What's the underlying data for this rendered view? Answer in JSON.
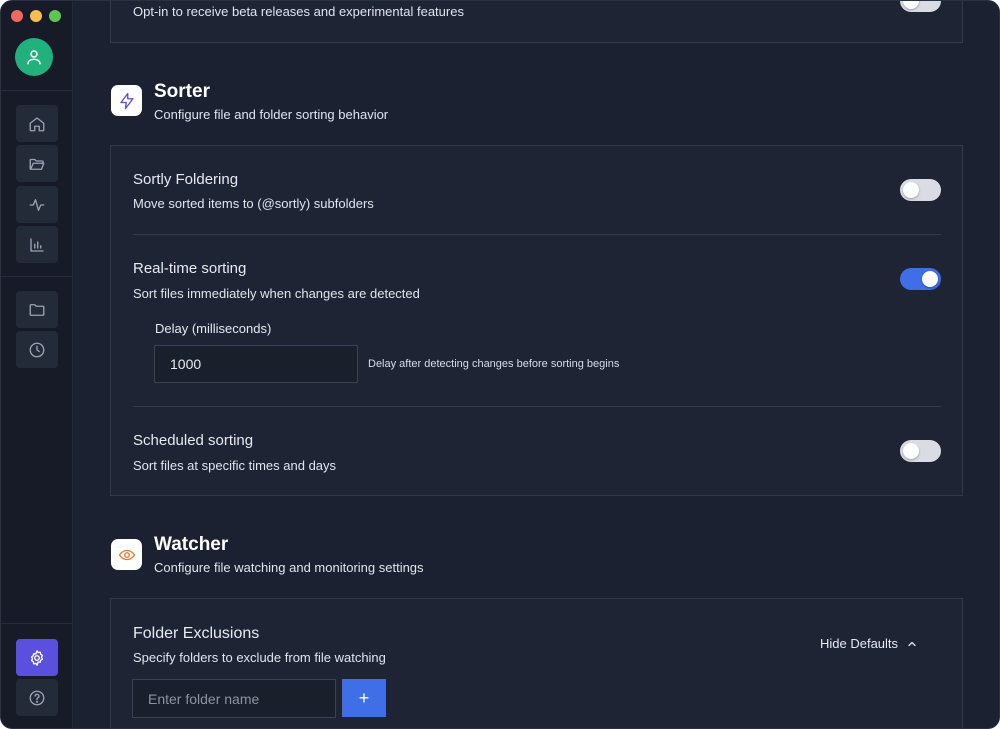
{
  "top_setting": {
    "description": "Opt-in to receive beta releases and experimental features"
  },
  "sorter": {
    "title": "Sorter",
    "subtitle": "Configure file and folder sorting behavior",
    "icon": "lightning-icon",
    "settings": [
      {
        "title": "Sortly Foldering",
        "description": "Move sorted items to (@sortly) subfolders",
        "enabled": false
      },
      {
        "title": "Real-time sorting",
        "description": "Sort files immediately when changes are detected",
        "enabled": true
      },
      {
        "title": "Scheduled sorting",
        "description": "Sort files at specific times and days",
        "enabled": false
      }
    ],
    "delay": {
      "label": "Delay (milliseconds)",
      "value": "1000",
      "hint": "Delay after detecting changes before sorting begins"
    }
  },
  "watcher": {
    "title": "Watcher",
    "subtitle": "Configure file watching and monitoring settings",
    "icon": "eye-icon",
    "exclusions": {
      "title": "Folder Exclusions",
      "description": "Specify folders to exclude from file watching",
      "hide_defaults_label": "Hide Defaults",
      "placeholder": "Enter folder name",
      "add_label": "+"
    }
  },
  "colors": {
    "accent_blue": "#3f6ee6",
    "active_nav": "#5b4fe0",
    "avatar": "#22b07d",
    "watcher_icon": "#e8792b",
    "sorter_icon": "#5b4fe0"
  }
}
